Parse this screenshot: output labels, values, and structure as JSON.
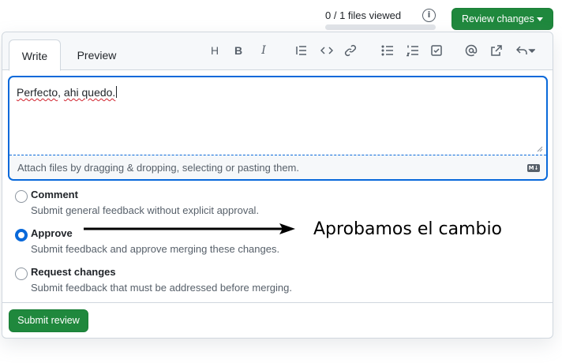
{
  "header": {
    "files_viewed": "0 / 1 files viewed",
    "files_viewed_progress": 0,
    "review_button_label": "Review changes"
  },
  "tabs": [
    {
      "label": "Write",
      "active": true
    },
    {
      "label": "Preview",
      "active": false
    }
  ],
  "toolbar": {
    "icons": [
      "heading-icon",
      "bold-icon",
      "italic-icon",
      "quote-icon",
      "code-icon",
      "link-icon",
      "bulleted-list-icon",
      "numbered-list-icon",
      "task-list-icon",
      "mention-icon",
      "cross-reference-icon",
      "reply-icon"
    ],
    "heading_glyph": "H",
    "bold_glyph": "B",
    "italic_glyph": "I"
  },
  "editor": {
    "value": "Perfecto, ahi quedo.",
    "value_underlined": [
      "Perfecto",
      "ahi quedo."
    ],
    "attach_text": "Attach files by dragging & dropping, selecting or pasting them.",
    "markdown_badge": "M↓"
  },
  "options": [
    {
      "label": "Comment",
      "description": "Submit general feedback without explicit approval.",
      "checked": false
    },
    {
      "label": "Approve",
      "description": "Submit feedback and approve merging these changes.",
      "checked": true
    },
    {
      "label": "Request changes",
      "description": "Submit feedback that must be addressed before merging.",
      "checked": false
    }
  ],
  "annotation": {
    "text": "Aprobamos el cambio"
  },
  "footer": {
    "submit_label": "Submit review"
  },
  "colors": {
    "primary_green": "#1f883d",
    "focus_blue": "#0969da",
    "muted_text": "#57606a"
  }
}
